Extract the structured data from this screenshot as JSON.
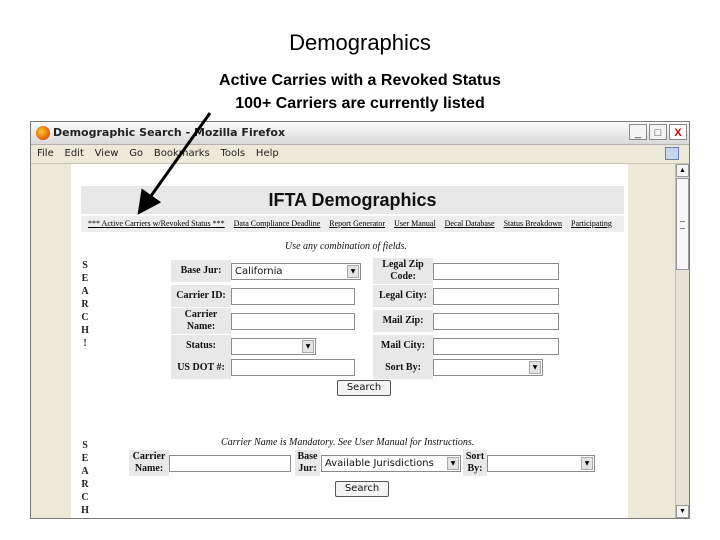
{
  "slide": {
    "title": "Demographics",
    "subtitle_line1": "Active Carries with a Revoked Status",
    "subtitle_line2": "100+ Carriers are currently listed"
  },
  "browser": {
    "window_title": "Demographic Search - Mozilla Firefox",
    "controls": {
      "minimize": "_",
      "maximize": "□",
      "close": "X"
    },
    "menu": [
      "File",
      "Edit",
      "View",
      "Go",
      "Bookmarks",
      "Tools",
      "Help"
    ]
  },
  "page": {
    "title": "IFTA Demographics",
    "nav": [
      "*** Active Carriers w/Revoked Status ***",
      "Data Compliance Deadline",
      "Report Generator",
      "User Manual",
      "Decal Database",
      "Status Breakdown",
      "Participating"
    ],
    "search1": {
      "hint": "Use any combination of fields.",
      "vertical": [
        "S",
        "E",
        "A",
        "R",
        "C",
        "H",
        "!"
      ],
      "base_jur_label": "Base Jur:",
      "base_jur_value": "California",
      "legal_zip_label1": "Legal Zip",
      "legal_zip_label2": "Code:",
      "carrier_id_label": "Carrier ID:",
      "legal_city_label": "Legal City:",
      "carrier_name_label1": "Carrier",
      "carrier_name_label2": "Name:",
      "mail_zip_label": "Mail Zip:",
      "status_label": "Status:",
      "mail_city_label": "Mail City:",
      "usdot_label": "US DOT #:",
      "sort_by_label": "Sort By:",
      "search_button": "Search"
    },
    "search2": {
      "hint": "Carrier Name is Mandatory. See User Manual for Instructions.",
      "vertical": [
        "S",
        "E",
        "A",
        "R",
        "C",
        "H"
      ],
      "carrier_label1": "Carrier",
      "carrier_label2": "Name:",
      "base_label1": "Base",
      "base_label2": "Jur:",
      "base_value": "Available Jurisdictions",
      "sort_label1": "Sort",
      "sort_label2": "By:",
      "search_button": "Search"
    }
  }
}
